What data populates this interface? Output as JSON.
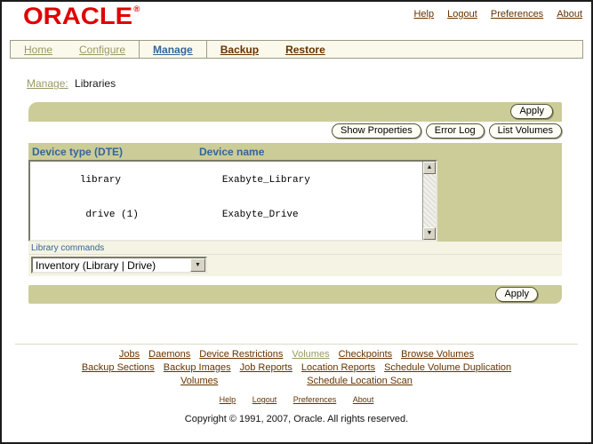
{
  "brand": {
    "logo": "ORACLE",
    "registered": "®"
  },
  "header_links": {
    "help": "Help",
    "logout": "Logout",
    "preferences": "Preferences",
    "about": "About"
  },
  "tabs": [
    {
      "label": "Home"
    },
    {
      "label": "Configure"
    },
    {
      "label": "Manage"
    },
    {
      "label": "Backup"
    },
    {
      "label": "Restore"
    }
  ],
  "breadcrumb": {
    "section": "Manage:",
    "page": "Libraries"
  },
  "toolbar": {
    "apply_label": "Apply",
    "show_properties": "Show Properties",
    "error_log": "Error Log",
    "list_volumes": "List Volumes"
  },
  "device_table": {
    "columns": {
      "type": "Device type (DTE)",
      "name": "Device name"
    },
    "rows": [
      {
        "type": "library",
        "name": "Exabyte_Library"
      },
      {
        "type": " drive (1)",
        "name": "Exabyte_Drive"
      }
    ]
  },
  "library_commands": {
    "label": "Library commands",
    "selected_option": "Inventory (Library | Drive)"
  },
  "icons": {
    "scroll_up": "▲",
    "scroll_down": "▼",
    "dropdown_arrow": "▼"
  },
  "footer": {
    "link_rows": [
      [
        "Jobs",
        "Daemons",
        "Device Restrictions",
        "Volumes",
        "Checkpoints",
        "Browse Volumes"
      ],
      [
        "Backup Sections",
        "Backup Images",
        "Job Reports",
        "Location Reports",
        "Schedule Volume Duplication"
      ],
      [
        "Volumes",
        "Schedule Location Scan"
      ]
    ],
    "small_links": {
      "help": "Help",
      "logout": "Logout",
      "preferences": "Preferences",
      "about": "About"
    },
    "copyright": "Copyright © 1991, 2007, Oracle. All rights reserved."
  },
  "colors": {
    "oracle_red": "#e00000",
    "bar_tan": "#cccc99",
    "row_cream": "#f5f3e3",
    "heading_blue": "#336699",
    "link_brown": "#663300",
    "link_light": "#999966"
  }
}
